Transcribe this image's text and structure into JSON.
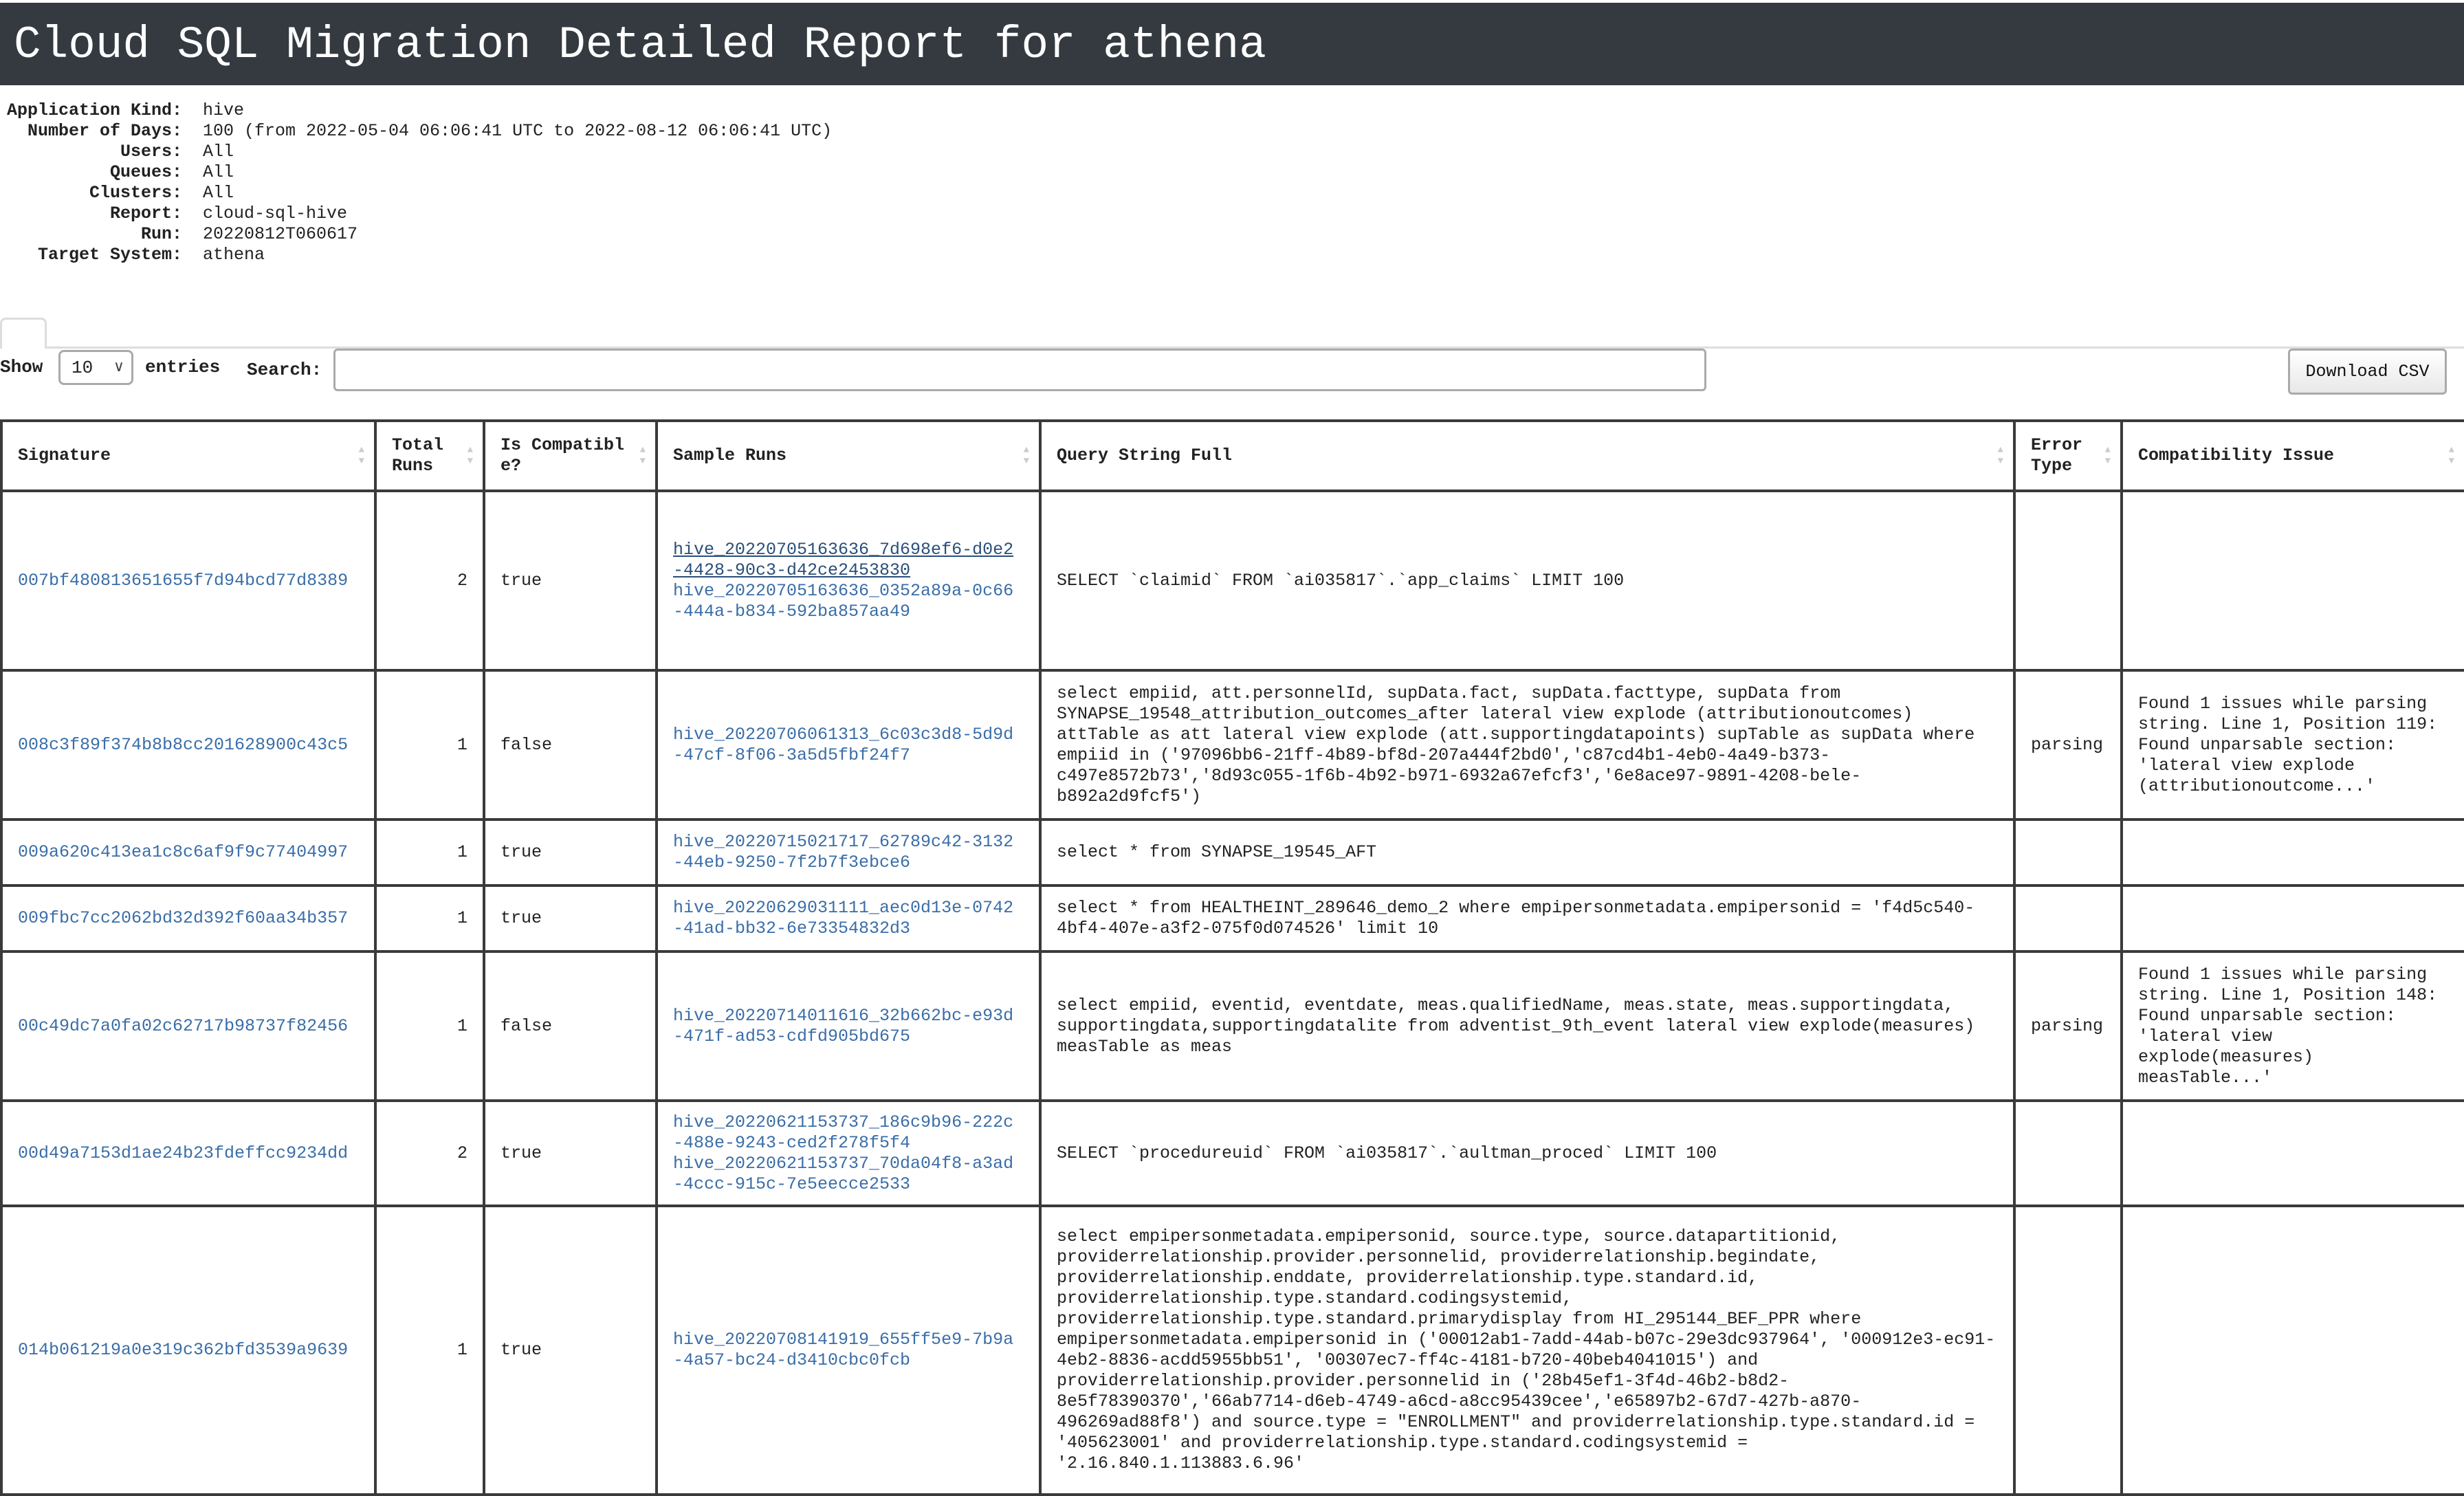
{
  "header": {
    "title": "Cloud SQL Migration Detailed Report for athena",
    "bg_color": "#343a40"
  },
  "meta": [
    {
      "label": "Application Kind:",
      "value": "hive"
    },
    {
      "label": "Number of Days:",
      "value": "100 (from 2022-05-04 06:06:41 UTC to 2022-08-12 06:06:41 UTC)"
    },
    {
      "label": "Users:",
      "value": "All"
    },
    {
      "label": "Queues:",
      "value": "All"
    },
    {
      "label": "Clusters:",
      "value": "All"
    },
    {
      "label": "Report:",
      "value": "cloud-sql-hive"
    },
    {
      "label": "Run:",
      "value": "20220812T060617"
    },
    {
      "label": "Target System:",
      "value": "athena"
    }
  ],
  "controls": {
    "show_label": "Show",
    "entries_value": "10",
    "entries_label": "entries",
    "search_label": "Search:",
    "search_value": "",
    "download_label": "Download CSV"
  },
  "table": {
    "columns": [
      "Signature",
      "Total Runs",
      "Is Compatible?",
      "Sample Runs",
      "Query String Full",
      "Error Type",
      "Compatibility Issue"
    ],
    "rows": [
      {
        "signature": "007bf480813651655f7d94bcd77d8389",
        "total_runs": "2",
        "compatible": "true",
        "sample_runs": [
          "hive_20220705163636_7d698ef6-d0e2-4428-90c3-d42ce2453830",
          "hive_20220705163636_0352a89a-0c66-444a-b834-592ba857aa49"
        ],
        "query": "SELECT `claimid` FROM `ai035817`.`app_claims` LIMIT 100",
        "error_type": "",
        "issue": ""
      },
      {
        "signature": "008c3f89f374b8b8cc201628900c43c5",
        "total_runs": "1",
        "compatible": "false",
        "sample_runs": [
          "hive_20220706061313_6c03c3d8-5d9d-47cf-8f06-3a5d5fbf24f7"
        ],
        "query": "select empiid, att.personnelId, supData.fact, supData.facttype, supData from SYNAPSE_19548_attribution_outcomes_after lateral view explode (attributionoutcomes) attTable as att lateral view explode (att.supportingdatapoints) supTable as supData where empiid in ('97096bb6-21ff-4b89-bf8d-207a444f2bd0','c87cd4b1-4eb0-4a49-b373-c497e8572b73','8d93c055-1f6b-4b92-b971-6932a67efcf3','6e8ace97-9891-4208-bele-b892a2d9fcf5')",
        "error_type": "parsing",
        "issue": "Found 1 issues while parsing string. Line 1, Position 119: Found unparsable section: 'lateral view explode (attributionoutcome...'"
      },
      {
        "signature": "009a620c413ea1c8c6af9f9c77404997",
        "total_runs": "1",
        "compatible": "true",
        "sample_runs": [
          "hive_20220715021717_62789c42-3132-44eb-9250-7f2b7f3ebce6"
        ],
        "query": "select * from SYNAPSE_19545_AFT",
        "error_type": "",
        "issue": ""
      },
      {
        "signature": "009fbc7cc2062bd32d392f60aa34b357",
        "total_runs": "1",
        "compatible": "true",
        "sample_runs": [
          "hive_20220629031111_aec0d13e-0742-41ad-bb32-6e73354832d3"
        ],
        "query": "select * from HEALTHEINT_289646_demo_2 where empipersonmetadata.empipersonid = 'f4d5c540-4bf4-407e-a3f2-075f0d074526' limit 10",
        "error_type": "",
        "issue": ""
      },
      {
        "signature": "00c49dc7a0fa02c62717b98737f82456",
        "total_runs": "1",
        "compatible": "false",
        "sample_runs": [
          "hive_20220714011616_32b662bc-e93d-471f-ad53-cdfd905bd675"
        ],
        "query": "select empiid, eventid, eventdate, meas.qualifiedName, meas.state, meas.supportingdata, supportingdata,supportingdatalite from adventist_9th_event lateral view explode(measures) measTable as meas",
        "error_type": "parsing",
        "issue": "Found 1 issues while parsing string. Line 1, Position 148: Found unparsable section: 'lateral view explode(measures) measTable...'"
      },
      {
        "signature": "00d49a7153d1ae24b23fdeffcc9234dd",
        "total_runs": "2",
        "compatible": "true",
        "sample_runs": [
          "hive_20220621153737_186c9b96-222c-488e-9243-ced2f278f5f4",
          "hive_20220621153737_70da04f8-a3ad-4ccc-915c-7e5eecce2533"
        ],
        "query": "SELECT `procedureuid` FROM `ai035817`.`aultman_proced` LIMIT 100",
        "error_type": "",
        "issue": ""
      },
      {
        "signature": "014b061219a0e319c362bfd3539a9639",
        "total_runs": "1",
        "compatible": "true",
        "sample_runs": [
          "hive_20220708141919_655ff5e9-7b9a-4a57-bc24-d3410cbc0fcb"
        ],
        "query": "select empipersonmetadata.empipersonid, source.type, source.datapartitionid, providerrelationship.provider.personnelid, providerrelationship.begindate, providerrelationship.enddate, providerrelationship.type.standard.id, providerrelationship.type.standard.codingsystemid, providerrelationship.type.standard.primarydisplay from HI_295144_BEF_PPR where empipersonmetadata.empipersonid in ('00012ab1-7add-44ab-b07c-29e3dc937964', '000912e3-ec91-4eb2-8836-acdd5955bb51', '00307ec7-ff4c-4181-b720-40beb4041015') and providerrelationship.provider.personnelid in ('28b45ef1-3f4d-46b2-b8d2-8e5f78390370','66ab7714-d6eb-4749-a6cd-a8cc95439cee','e65897b2-67d7-427b-a870-496269ad88f8') and source.type = \"ENROLLMENT\" and providerrelationship.type.standard.id = '405623001' and providerrelationship.type.standard.codingsystemid = '2.16.840.1.113883.6.96'",
        "error_type": "",
        "issue": ""
      }
    ]
  },
  "colors": {
    "link": "#3a6ea8",
    "border": "#3a3a3a"
  }
}
